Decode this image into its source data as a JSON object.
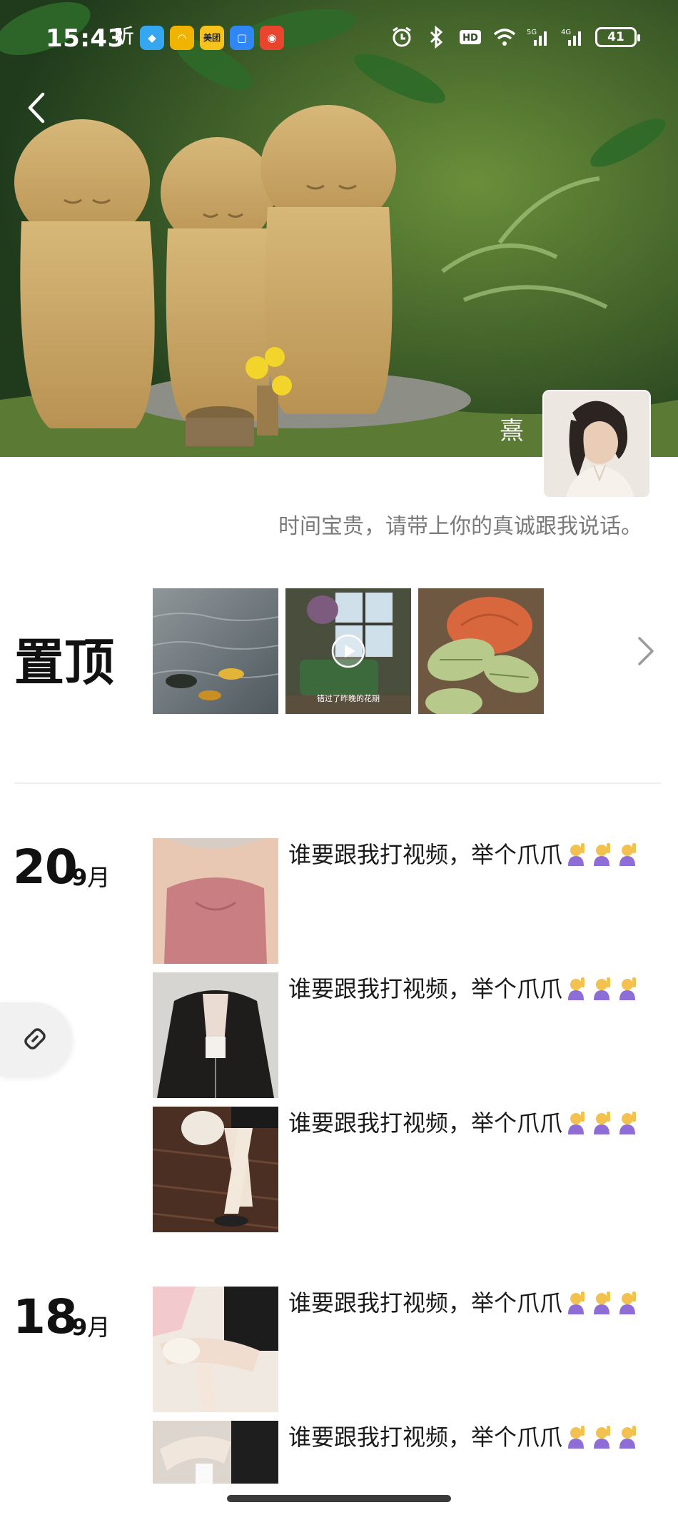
{
  "status_bar": {
    "time": "15:43",
    "battery": "41",
    "apps": [
      {
        "icon": "listen-icon",
        "label": "听",
        "color": "#ffffff"
      },
      {
        "icon": "qq-icon",
        "label": "",
        "color": "#35a6f0"
      },
      {
        "icon": "app-yellow-icon",
        "label": "",
        "color": "#f0b400"
      },
      {
        "icon": "meituan-icon",
        "label": "美团",
        "color": "#f6c21c"
      },
      {
        "icon": "app-blue-icon",
        "label": "",
        "color": "#2f86f6"
      },
      {
        "icon": "weibo-icon",
        "label": "",
        "color": "#e8442e"
      }
    ]
  },
  "profile": {
    "name": "熹",
    "signature": "时间宝贵，请带上你的真诚跟我说话。"
  },
  "pinned": {
    "title": "置顶",
    "items": [
      {
        "type": "photo",
        "subject": "fish-in-water"
      },
      {
        "type": "video",
        "subject": "living-room",
        "caption": "错过了昨晚的花期"
      },
      {
        "type": "photo",
        "subject": "pumpkin-in-garden"
      }
    ]
  },
  "feed": [
    {
      "day": "20",
      "month": "9",
      "month_unit": "月",
      "posts": [
        {
          "text": "谁要跟我打视频，举个爪爪",
          "emoji_count": 3,
          "subject": "pink-top"
        },
        {
          "text": "谁要跟我打视频，举个爪爪",
          "emoji_count": 3,
          "subject": "black-jacket"
        },
        {
          "text": "谁要跟我打视频，举个爪爪",
          "emoji_count": 3,
          "subject": "legs-heels"
        }
      ]
    },
    {
      "day": "18",
      "month": "9",
      "month_unit": "月",
      "posts": [
        {
          "text": "谁要跟我打视频，举个爪爪",
          "emoji_count": 3,
          "subject": "sitting-legs"
        },
        {
          "text": "谁要跟我打视频，举个爪爪",
          "emoji_count": 3,
          "subject": "legs-partial"
        }
      ]
    }
  ],
  "colors": {
    "accent_text": "#1a1a1a",
    "signature": "#7a7a7a",
    "divider": "#eeeeee"
  }
}
